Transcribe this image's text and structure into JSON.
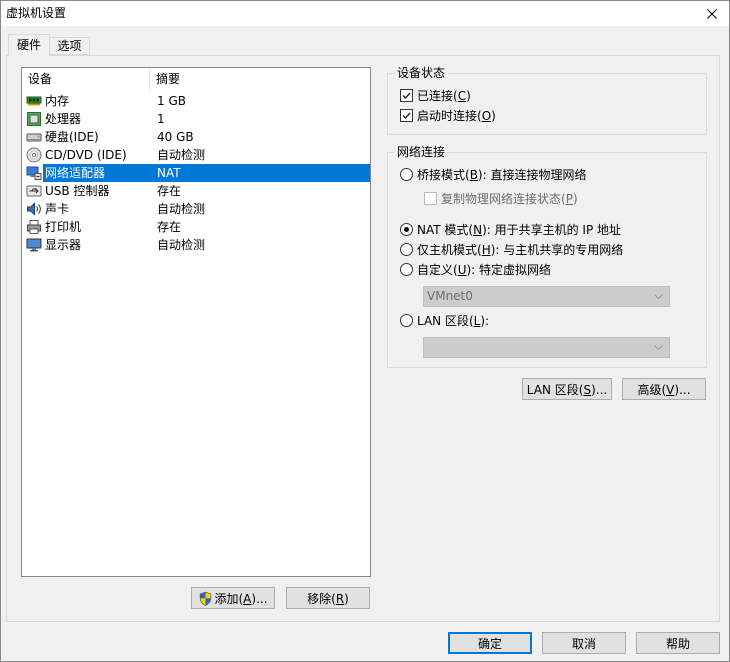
{
  "window": {
    "title": "虚拟机设置",
    "close_icon": "close-icon"
  },
  "tabs": [
    {
      "label": "硬件",
      "selected": true
    },
    {
      "label": "选项"
    }
  ],
  "device_list": {
    "headers": {
      "device": "设备",
      "summary": "摘要"
    },
    "items": [
      {
        "icon": "memory-icon",
        "name": "内存",
        "summary": "1 GB"
      },
      {
        "icon": "processor-icon",
        "name": "处理器",
        "summary": "1"
      },
      {
        "icon": "hard-disk-icon",
        "name": "硬盘(IDE)",
        "summary": "40 GB"
      },
      {
        "icon": "cd-dvd-icon",
        "name": "CD/DVD (IDE)",
        "summary": "自动检测"
      },
      {
        "icon": "network-adapter-icon",
        "name": "网络适配器",
        "summary": "NAT",
        "selected": true
      },
      {
        "icon": "usb-controller-icon",
        "name": "USB 控制器",
        "summary": "存在"
      },
      {
        "icon": "sound-card-icon",
        "name": "声卡",
        "summary": "自动检测"
      },
      {
        "icon": "printer-icon",
        "name": "打印机",
        "summary": "存在"
      },
      {
        "icon": "display-icon",
        "name": "显示器",
        "summary": "自动检测"
      }
    ]
  },
  "list_buttons": {
    "add": {
      "icon": "shield-icon",
      "pre": "添加(",
      "key": "A",
      "post": ")..."
    },
    "remove": {
      "pre": "移除(",
      "key": "R",
      "post": ")"
    }
  },
  "device_status": {
    "title": "设备状态",
    "connected": {
      "checked": true,
      "pre": "已连接(",
      "key": "C",
      "post": ")"
    },
    "connect_at_power_on": {
      "checked": true,
      "pre": "启动时连接(",
      "key": "O",
      "post": ")"
    }
  },
  "network_connection": {
    "title": "网络连接",
    "bridged": {
      "checked": false,
      "pre": "桥接模式(",
      "key": "B",
      "post": "): 直接连接物理网络"
    },
    "replicate_state": {
      "checked": false,
      "disabled": true,
      "pre": "复制物理网络连接状态(",
      "key": "P",
      "post": ")"
    },
    "nat": {
      "checked": true,
      "pre": "NAT 模式(",
      "key": "N",
      "post": "): 用于共享主机的 IP 地址"
    },
    "host_only": {
      "checked": false,
      "pre": "仅主机模式(",
      "key": "H",
      "post": "): 与主机共享的专用网络"
    },
    "custom": {
      "checked": false,
      "pre": "自定义(",
      "key": "U",
      "post": "): 特定虚拟网络"
    },
    "custom_network_select": {
      "value": "VMnet0",
      "disabled": true,
      "icon": "chevron-down-icon"
    },
    "lan_segment": {
      "checked": false,
      "pre": "LAN 区段(",
      "key": "L",
      "post": "):"
    },
    "lan_segment_select": {
      "disabled": true,
      "icon": "chevron-down-icon"
    }
  },
  "adapter_buttons": {
    "lan_segments": {
      "pre": "LAN 区段(",
      "key": "S",
      "post": ")..."
    },
    "advanced": {
      "pre": "高级(",
      "key": "V",
      "post": ")..."
    }
  },
  "dialog_buttons": {
    "ok": {
      "label": "确定",
      "default": true
    },
    "cancel": {
      "label": "取消"
    },
    "help": {
      "label": "帮助"
    }
  },
  "colors": {
    "selection": "#0078d7",
    "dialog_bg": "#f0f0f0",
    "list_bg": "#ffffff",
    "button_bg": "#e1e1e1",
    "button_border": "#adadad",
    "default_button_border": "#0078d7",
    "disabled_text": "#6d6d6d",
    "disabled_field_bg": "#cccccc"
  }
}
